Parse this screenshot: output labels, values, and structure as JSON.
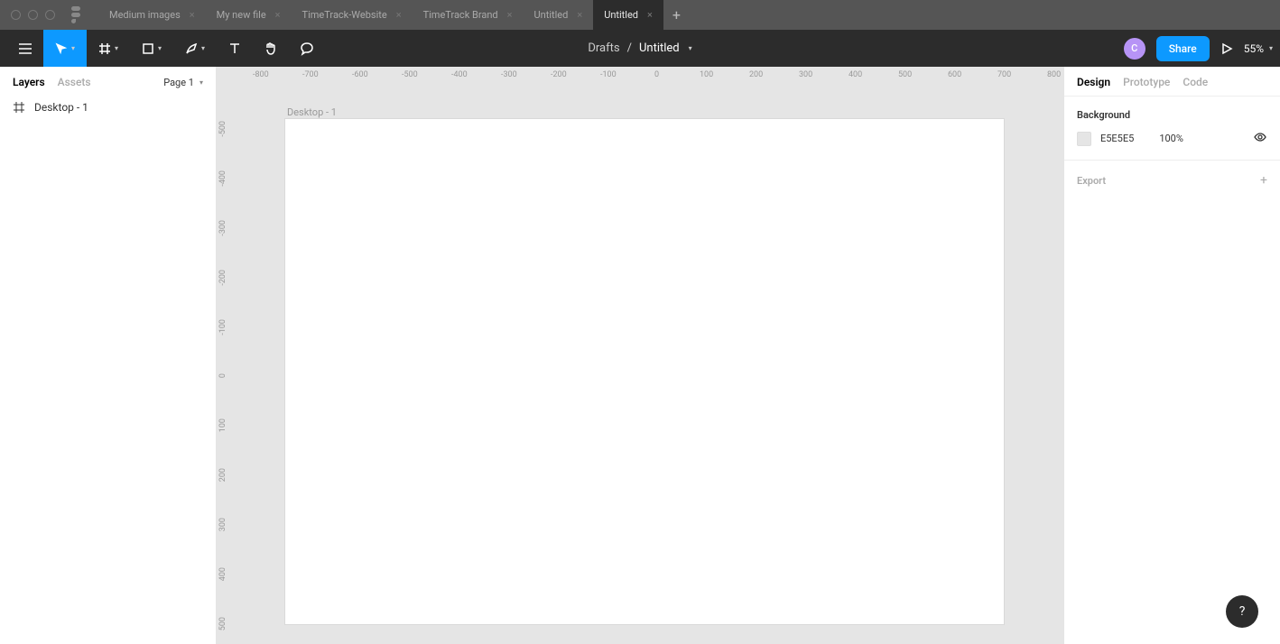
{
  "titlebar": {
    "tabs": [
      {
        "label": "Medium images"
      },
      {
        "label": "My new file"
      },
      {
        "label": "TimeTrack-Website"
      },
      {
        "label": "TimeTrack Brand"
      },
      {
        "label": "Untitled"
      },
      {
        "label": "Untitled"
      }
    ]
  },
  "toolbar": {
    "breadcrumb_parent": "Drafts",
    "breadcrumb_sep": "/",
    "breadcrumb_current": "Untitled",
    "avatar_initial": "C",
    "share_label": "Share",
    "zoom": "55%"
  },
  "left_panel": {
    "tab_layers": "Layers",
    "tab_assets": "Assets",
    "page_label": "Page 1",
    "layer_name": "Desktop - 1"
  },
  "canvas": {
    "frame_label": "Desktop - 1",
    "ruler_h": [
      "-800",
      "-700",
      "-600",
      "-500",
      "-400",
      "-300",
      "-200",
      "-100",
      "0",
      "100",
      "200",
      "300",
      "400",
      "500",
      "600",
      "700",
      "800"
    ],
    "ruler_v": [
      "-500",
      "-400",
      "-300",
      "-200",
      "-100",
      "0",
      "100",
      "200",
      "300",
      "400",
      "500"
    ]
  },
  "right_panel": {
    "tab_design": "Design",
    "tab_prototype": "Prototype",
    "tab_code": "Code",
    "bg_title": "Background",
    "bg_color": "E5E5E5",
    "bg_opacity": "100%",
    "export_title": "Export"
  },
  "help": "?"
}
